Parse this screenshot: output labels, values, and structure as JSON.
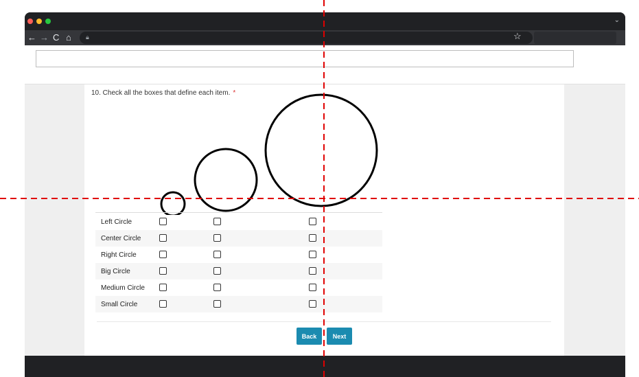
{
  "browser": {
    "nav": {
      "back": "←",
      "forward": "→",
      "reload": "C",
      "home": "⌂"
    },
    "lock_icon": "lock-icon",
    "star_icon": "☆",
    "chevron": "⌄"
  },
  "question": {
    "text": "10. Check all the boxes that define each item.",
    "required_mark": "*"
  },
  "rows": [
    {
      "label": "Left Circle"
    },
    {
      "label": "Center Circle"
    },
    {
      "label": "Right Circle"
    },
    {
      "label": "Big Circle"
    },
    {
      "label": "Medium Circle"
    },
    {
      "label": "Small Circle"
    }
  ],
  "buttons": {
    "back": "Back",
    "next": "Next"
  },
  "colors": {
    "accent": "#1b8bb0",
    "required": "#dd3333",
    "guide": "#e00000"
  }
}
